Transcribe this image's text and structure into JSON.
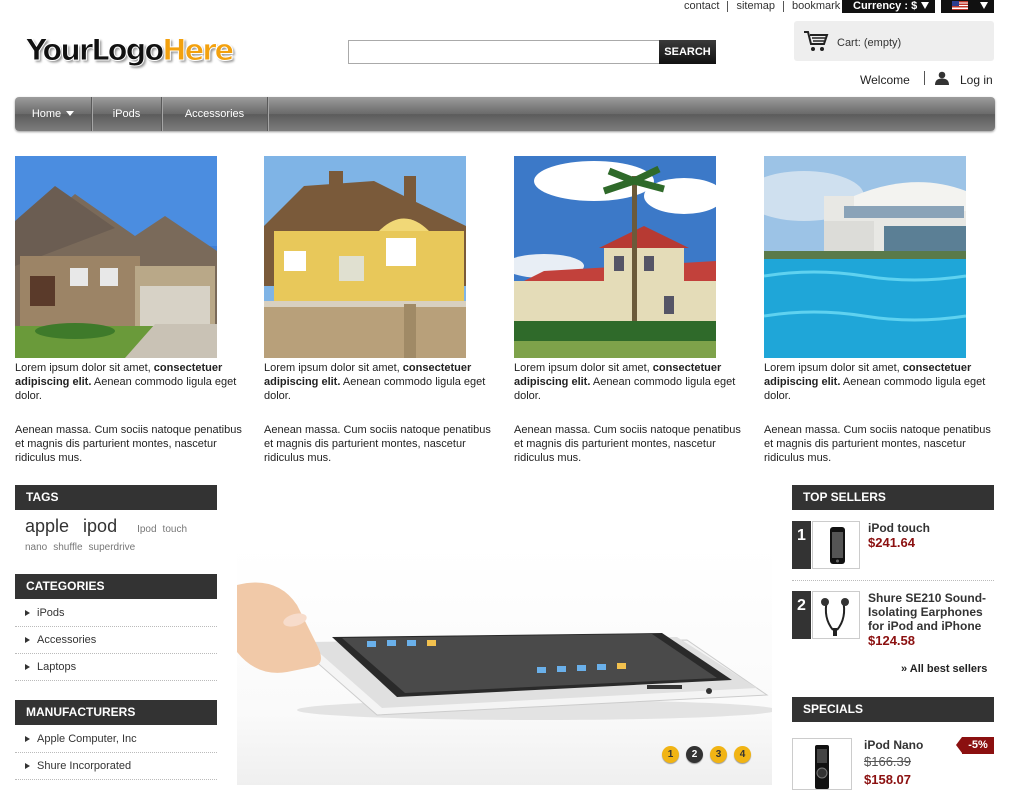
{
  "top_links": {
    "contact": "contact",
    "sitemap": "sitemap",
    "bookmark": "bookmark",
    "currency_label": "Currency : $"
  },
  "logo": {
    "part1": "YourLogo",
    "part2": "Here"
  },
  "search": {
    "value": "",
    "button": "SEARCH"
  },
  "cart": {
    "label": "Cart: (empty)"
  },
  "user": {
    "welcome": "Welcome",
    "login": "Log in"
  },
  "nav": {
    "items": [
      {
        "label": "Home"
      },
      {
        "label": "iPods"
      },
      {
        "label": "Accessories"
      }
    ]
  },
  "features": [
    {
      "bold": "consectetuer adipiscing elit.",
      "lead": "Lorem ipsum dolor sit amet,",
      "tail": "Aenean commodo ligula eget dolor.",
      "para2": "Aenean massa. Cum sociis natoque penatibus et magnis dis parturient montes, nascetur ridiculus mus."
    },
    {
      "bold": "consectetuer adipiscing elit.",
      "lead": "Lorem ipsum dolor sit amet,",
      "tail": "Aenean commodo ligula eget dolor.",
      "para2": "Aenean massa. Cum sociis natoque penatibus et magnis dis parturient montes, nascetur ridiculus mus."
    },
    {
      "bold": "consectetuer adipiscing elit.",
      "lead": "Lorem ipsum dolor sit amet,",
      "tail": "Aenean commodo ligula eget dolor.",
      "para2": "Aenean massa. Cum sociis natoque penatibus et magnis dis parturient montes, nascetur ridiculus mus."
    },
    {
      "bold": "consectetuer adipiscing elit.",
      "lead": "Lorem ipsum dolor sit amet,",
      "tail": "Aenean commodo ligula eget dolor.",
      "para2": "Aenean massa. Cum sociis natoque penatibus et magnis dis parturient montes, nascetur ridiculus mus."
    }
  ],
  "tags": {
    "title": "TAGS",
    "big": [
      "apple",
      "ipod"
    ],
    "small": [
      "Ipod",
      "touch",
      "nano",
      "shuffle",
      "superdrive"
    ]
  },
  "categories": {
    "title": "CATEGORIES",
    "items": [
      "iPods",
      "Accessories",
      "Laptops"
    ]
  },
  "manufacturers": {
    "title": "MANUFACTURERS",
    "items": [
      "Apple Computer, Inc",
      "Shure Incorporated"
    ]
  },
  "slider": {
    "dots": [
      "1",
      "2",
      "3",
      "4"
    ],
    "active_index": 1
  },
  "top_sellers": {
    "title": "TOP SELLERS",
    "items": [
      {
        "rank": "1",
        "name": "iPod touch",
        "price": "$241.64"
      },
      {
        "rank": "2",
        "name": "Shure SE210 Sound-Isolating Earphones for iPod and iPhone",
        "price": "$124.58"
      }
    ],
    "all_link": "» All best sellers"
  },
  "specials": {
    "title": "SPECIALS",
    "item": {
      "name": "iPod Nano",
      "old_price": "$166.39",
      "price": "$158.07",
      "discount": "-5%"
    }
  },
  "colors": {
    "accent": "#f1b414",
    "price": "#8b1010",
    "header_bar": "#333333"
  }
}
